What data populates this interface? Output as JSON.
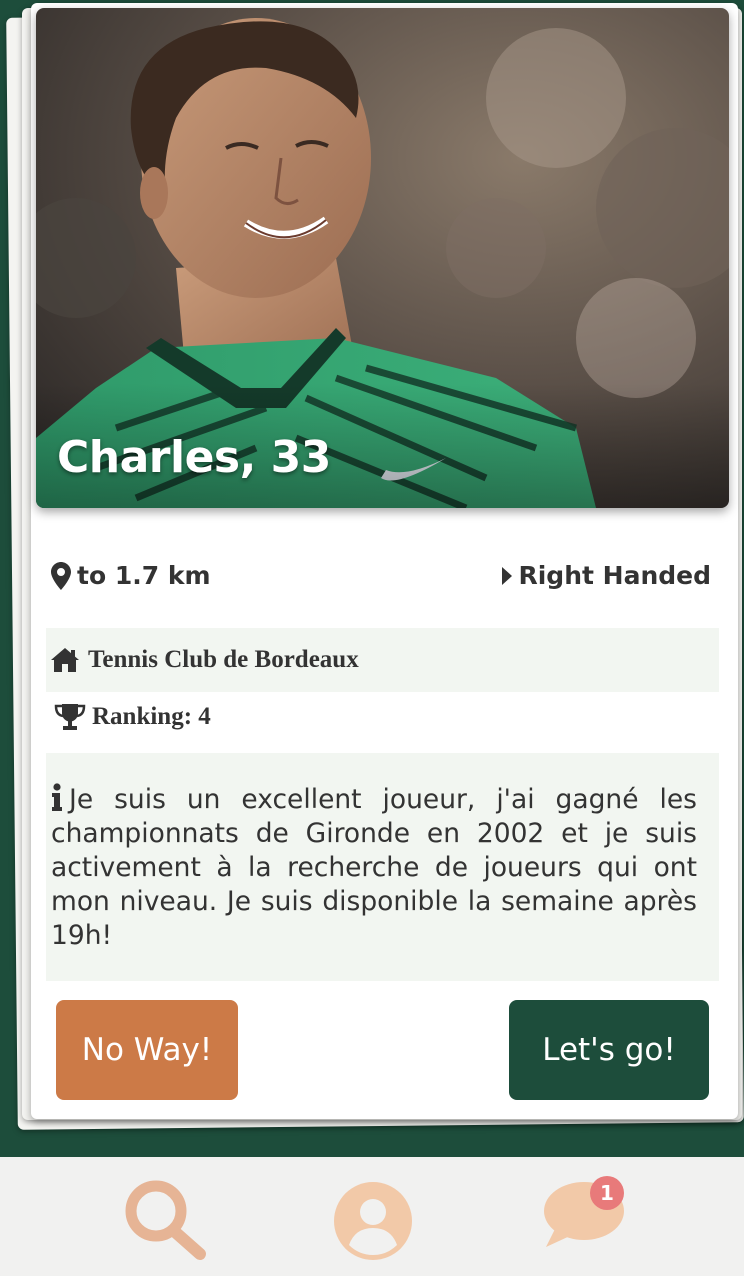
{
  "profile": {
    "name_age": "Charles, 33",
    "distance": "to 1.7 km",
    "handedness": "Right Handed",
    "club": "Tennis Club de Bordeaux",
    "ranking": "Ranking: 4",
    "bio": "Je suis un excellent joueur, j'ai gagné les championnats de Gironde en 2002 et je suis activement à la recherche de joueurs qui ont mon niveau. Je suis disponible la semaine après 19h!"
  },
  "actions": {
    "reject_label": "No Way!",
    "accept_label": "Let's go!"
  },
  "tabbar": {
    "items": [
      {
        "icon": "search-icon"
      },
      {
        "icon": "user-icon"
      },
      {
        "icon": "chat-icon",
        "badge": "1"
      }
    ]
  },
  "colors": {
    "background": "#1d4d3b",
    "reject": "#cc7a47",
    "accept": "#1d4d3b",
    "tab_icon": "#e8b48f",
    "badge": "#e87a7a"
  }
}
